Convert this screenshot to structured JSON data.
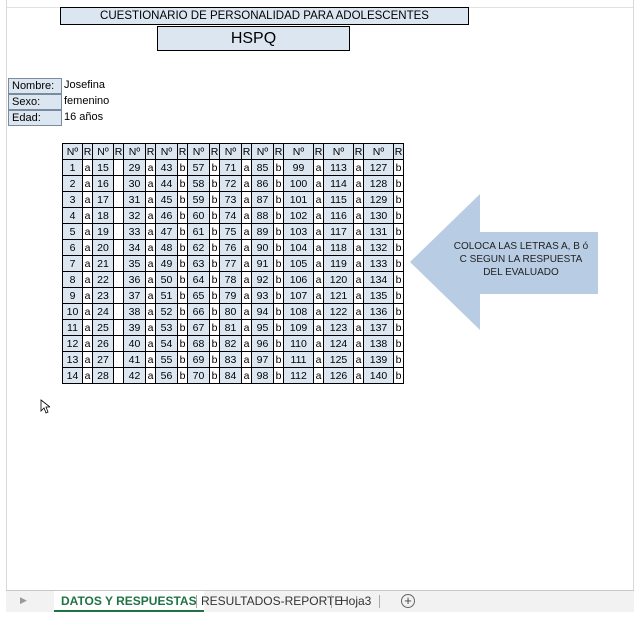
{
  "header": {
    "title": "CUESTIONARIO DE PERSONALIDAD PARA ADOLESCENTES",
    "subtitle": "HSPQ"
  },
  "info": [
    {
      "label": "Nombre:",
      "value": "Josefina"
    },
    {
      "label": "Sexo:",
      "value": "femenino"
    },
    {
      "label": "Edad:",
      "value": "16 años"
    }
  ],
  "grid": {
    "num_header": "Nº",
    "resp_header": "R",
    "rows": [
      [
        [
          "1",
          "a"
        ],
        [
          "15",
          ""
        ],
        [
          "29",
          "a"
        ],
        [
          "43",
          "b"
        ],
        [
          "57",
          "b"
        ],
        [
          "71",
          "a"
        ],
        [
          "85",
          "b"
        ],
        [
          "99",
          "a"
        ],
        [
          "113",
          "a"
        ],
        [
          "127",
          "b"
        ]
      ],
      [
        [
          "2",
          "a"
        ],
        [
          "16",
          ""
        ],
        [
          "30",
          "a"
        ],
        [
          "44",
          "b"
        ],
        [
          "58",
          "b"
        ],
        [
          "72",
          "a"
        ],
        [
          "86",
          "b"
        ],
        [
          "100",
          "a"
        ],
        [
          "114",
          "a"
        ],
        [
          "128",
          "b"
        ]
      ],
      [
        [
          "3",
          "a"
        ],
        [
          "17",
          ""
        ],
        [
          "31",
          "a"
        ],
        [
          "45",
          "b"
        ],
        [
          "59",
          "b"
        ],
        [
          "73",
          "a"
        ],
        [
          "87",
          "b"
        ],
        [
          "101",
          "a"
        ],
        [
          "115",
          "a"
        ],
        [
          "129",
          "b"
        ]
      ],
      [
        [
          "4",
          "a"
        ],
        [
          "18",
          ""
        ],
        [
          "32",
          "a"
        ],
        [
          "46",
          "b"
        ],
        [
          "60",
          "b"
        ],
        [
          "74",
          "a"
        ],
        [
          "88",
          "b"
        ],
        [
          "102",
          "a"
        ],
        [
          "116",
          "a"
        ],
        [
          "130",
          "b"
        ]
      ],
      [
        [
          "5",
          "a"
        ],
        [
          "19",
          ""
        ],
        [
          "33",
          "a"
        ],
        [
          "47",
          "b"
        ],
        [
          "61",
          "b"
        ],
        [
          "75",
          "a"
        ],
        [
          "89",
          "b"
        ],
        [
          "103",
          "a"
        ],
        [
          "117",
          "a"
        ],
        [
          "131",
          "b"
        ]
      ],
      [
        [
          "6",
          "a"
        ],
        [
          "20",
          ""
        ],
        [
          "34",
          "a"
        ],
        [
          "48",
          "b"
        ],
        [
          "62",
          "b"
        ],
        [
          "76",
          "a"
        ],
        [
          "90",
          "b"
        ],
        [
          "104",
          "a"
        ],
        [
          "118",
          "a"
        ],
        [
          "132",
          "b"
        ]
      ],
      [
        [
          "7",
          "a"
        ],
        [
          "21",
          ""
        ],
        [
          "35",
          "a"
        ],
        [
          "49",
          "b"
        ],
        [
          "63",
          "b"
        ],
        [
          "77",
          "a"
        ],
        [
          "91",
          "b"
        ],
        [
          "105",
          "a"
        ],
        [
          "119",
          "a"
        ],
        [
          "133",
          "b"
        ]
      ],
      [
        [
          "8",
          "a"
        ],
        [
          "22",
          ""
        ],
        [
          "36",
          "a"
        ],
        [
          "50",
          "b"
        ],
        [
          "64",
          "b"
        ],
        [
          "78",
          "a"
        ],
        [
          "92",
          "b"
        ],
        [
          "106",
          "a"
        ],
        [
          "120",
          "a"
        ],
        [
          "134",
          "b"
        ]
      ],
      [
        [
          "9",
          "a"
        ],
        [
          "23",
          ""
        ],
        [
          "37",
          "a"
        ],
        [
          "51",
          "b"
        ],
        [
          "65",
          "b"
        ],
        [
          "79",
          "a"
        ],
        [
          "93",
          "b"
        ],
        [
          "107",
          "a"
        ],
        [
          "121",
          "a"
        ],
        [
          "135",
          "b"
        ]
      ],
      [
        [
          "10",
          "a"
        ],
        [
          "24",
          ""
        ],
        [
          "38",
          "a"
        ],
        [
          "52",
          "b"
        ],
        [
          "66",
          "b"
        ],
        [
          "80",
          "a"
        ],
        [
          "94",
          "b"
        ],
        [
          "108",
          "a"
        ],
        [
          "122",
          "a"
        ],
        [
          "136",
          "b"
        ]
      ],
      [
        [
          "11",
          "a"
        ],
        [
          "25",
          ""
        ],
        [
          "39",
          "a"
        ],
        [
          "53",
          "b"
        ],
        [
          "67",
          "b"
        ],
        [
          "81",
          "a"
        ],
        [
          "95",
          "b"
        ],
        [
          "109",
          "a"
        ],
        [
          "123",
          "a"
        ],
        [
          "137",
          "b"
        ]
      ],
      [
        [
          "12",
          "a"
        ],
        [
          "26",
          ""
        ],
        [
          "40",
          "a"
        ],
        [
          "54",
          "b"
        ],
        [
          "68",
          "b"
        ],
        [
          "82",
          "a"
        ],
        [
          "96",
          "b"
        ],
        [
          "110",
          "a"
        ],
        [
          "124",
          "a"
        ],
        [
          "138",
          "b"
        ]
      ],
      [
        [
          "13",
          "a"
        ],
        [
          "27",
          ""
        ],
        [
          "41",
          "a"
        ],
        [
          "55",
          "b"
        ],
        [
          "69",
          "b"
        ],
        [
          "83",
          "a"
        ],
        [
          "97",
          "b"
        ],
        [
          "111",
          "a"
        ],
        [
          "125",
          "a"
        ],
        [
          "139",
          "b"
        ]
      ],
      [
        [
          "14",
          "a"
        ],
        [
          "28",
          ""
        ],
        [
          "42",
          "a"
        ],
        [
          "56",
          "b"
        ],
        [
          "70",
          "b"
        ],
        [
          "84",
          "a"
        ],
        [
          "98",
          "b"
        ],
        [
          "112",
          "a"
        ],
        [
          "126",
          "a"
        ],
        [
          "140",
          "b"
        ]
      ]
    ]
  },
  "callout": {
    "text": "COLOCA LAS LETRAS A, B ó C SEGUN LA RESPUESTA DEL EVALUADO"
  },
  "tabs": [
    {
      "label": "DATOS Y RESPUESTAS",
      "active": true
    },
    {
      "label": "RESULTADOS-REPORTE",
      "active": false
    },
    {
      "label": "Hoja3",
      "active": false
    }
  ],
  "add_sheet_icon": "plus-circle-icon",
  "colors": {
    "header_fill": "#dce6f1",
    "arrow_fill": "#b8cce4",
    "active_tab": "#217346"
  }
}
